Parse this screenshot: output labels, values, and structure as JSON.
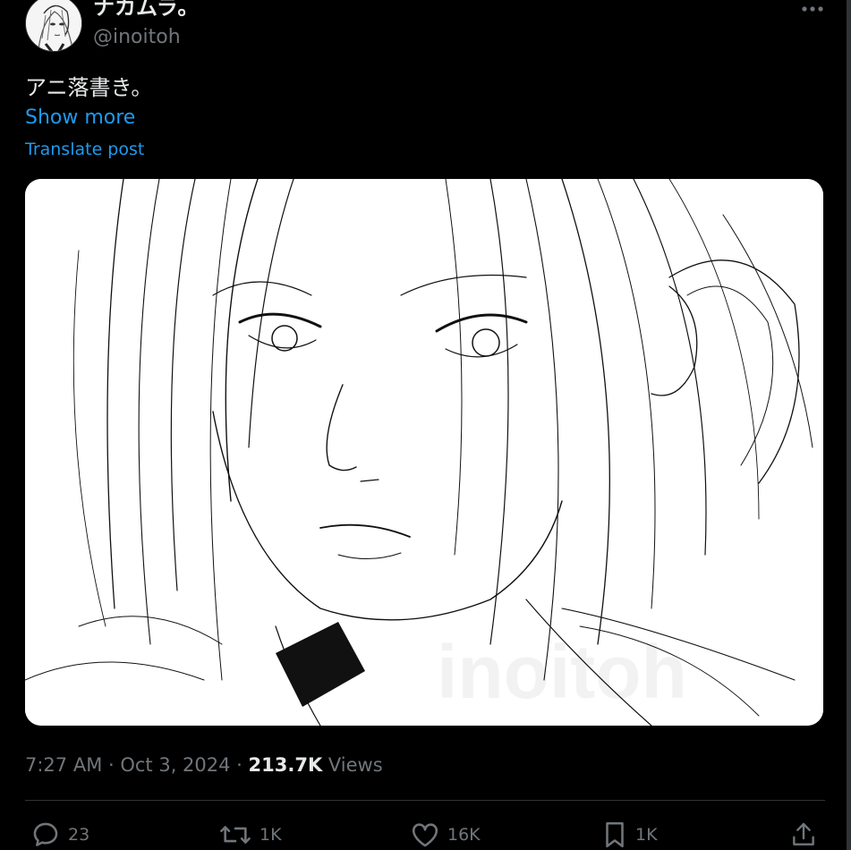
{
  "author": {
    "display_name": "ナカムラ。",
    "handle": "@inoitoh",
    "avatar_icon": "avatar-sketch-icon"
  },
  "post": {
    "text": "アニ落書き。",
    "show_more_label": "Show more",
    "translate_label": "Translate post",
    "media_watermark": "inoitoh",
    "timestamp": "7:27 AM · Oct 3, 2024 · ",
    "views_count": "213.7K",
    "views_label": " Views"
  },
  "actions": {
    "replies": "23",
    "reposts": "1K",
    "likes": "16K",
    "bookmarks": "1K"
  },
  "colors": {
    "background": "#000000",
    "text_primary": "#e7e9ea",
    "text_secondary": "#71767b",
    "link": "#1d9bf0",
    "border": "#2f3336"
  },
  "icons": [
    "more-icon",
    "reply-icon",
    "repost-icon",
    "like-icon",
    "bookmark-icon",
    "share-icon"
  ]
}
